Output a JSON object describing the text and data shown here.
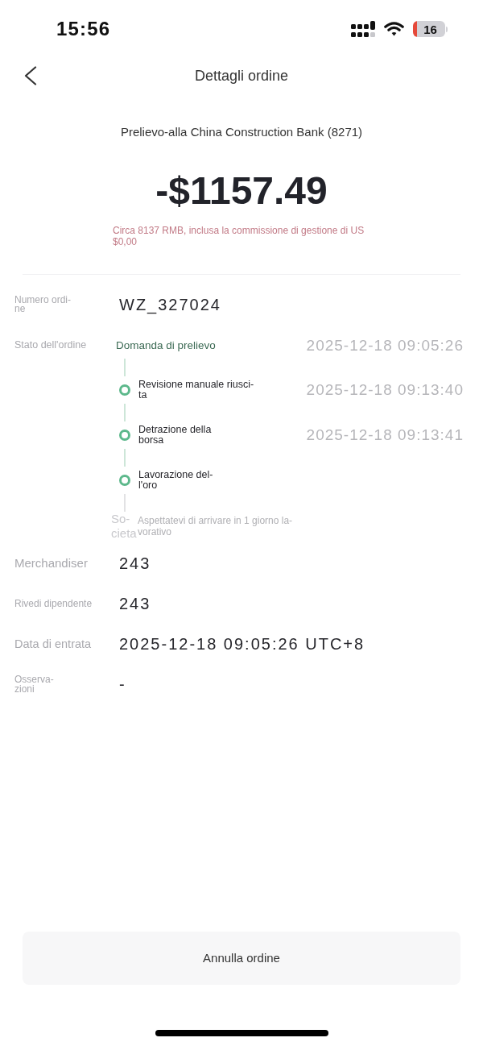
{
  "status_bar": {
    "time": "15:56",
    "battery": "16"
  },
  "header": {
    "title": "Dettagli ordine"
  },
  "summary": {
    "description": "Prelievo-alla China Construction Bank (8271)",
    "amount": "-$1157.49",
    "note": "Circa 8137 RMB, inclusa la commissione di gestione di US $0,00"
  },
  "details": [
    {
      "kind": "field",
      "label": "Numero ordi-ne",
      "value": "WZ_327024"
    },
    {
      "kind": "timeline",
      "label": "Stato dell'ordine",
      "current": {
        "label": "Domanda di prelievo",
        "time": "2025-12-18 09:05:26"
      },
      "steps": [
        {
          "label": "Revisione manuale riusci-ta",
          "time": "2025-12-18 09:13:40"
        },
        {
          "label": "Detrazione della borsa",
          "time": "2025-12-18 09:13:41"
        },
        {
          "label": "Lavorazione del-l'oro"
        }
      ],
      "note_label": "So-cieta",
      "note": "Aspettatevi di arrivare in 1 giorno la-vorativo"
    },
    {
      "kind": "field",
      "label": "Merchandiser",
      "value": "243"
    },
    {
      "kind": "field",
      "label": "Rivedi dipendente",
      "value": "243"
    },
    {
      "kind": "field",
      "label": "Data di entrata",
      "value": "2025-12-18 09:05:26 UTC+8"
    },
    {
      "kind": "field",
      "label": "Osserva-zioni",
      "value": "-"
    }
  ],
  "cancel_button": "Annulla ordine"
}
